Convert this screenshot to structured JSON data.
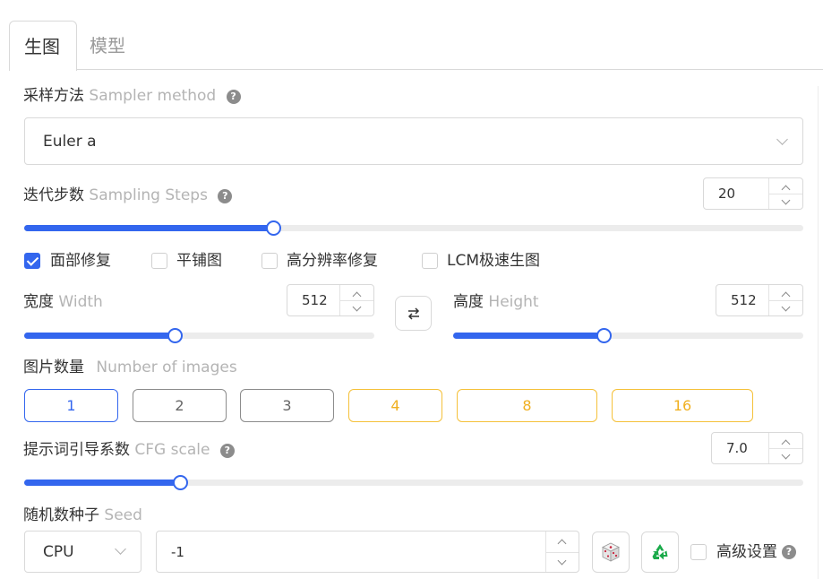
{
  "tabs": [
    {
      "label": "生图",
      "active": true
    },
    {
      "label": "模型",
      "active": false
    }
  ],
  "sampler": {
    "label_cn": "采样方法",
    "label_en": "Sampler method",
    "value": "Euler a"
  },
  "steps": {
    "label_cn": "迭代步数",
    "label_en": "Sampling Steps",
    "value": "20",
    "slider_fraction": 0.32
  },
  "options": [
    {
      "label": "面部修复",
      "checked": true
    },
    {
      "label": "平铺图",
      "checked": false
    },
    {
      "label": "高分辨率修复",
      "checked": false
    },
    {
      "label": "LCM极速生图",
      "checked": false
    }
  ],
  "width": {
    "label_cn": "宽度",
    "label_en": "Width",
    "value": "512",
    "slider_fraction": 0.43
  },
  "height": {
    "label_cn": "高度",
    "label_en": "Height",
    "value": "512",
    "slider_fraction": 0.43
  },
  "swap_icon": "swap-arrows-icon",
  "num_images": {
    "label_cn": "图片数量",
    "label_en": "Number of images",
    "options": [
      "1",
      "2",
      "3",
      "4",
      "8",
      "16"
    ],
    "selected": "1"
  },
  "cfg": {
    "label_cn": "提示词引导系数",
    "label_en": "CFG scale",
    "value": "7.0",
    "slider_fraction": 0.2
  },
  "seed": {
    "label_cn": "随机数种子",
    "label_en": "Seed",
    "device": "CPU",
    "value": "-1",
    "dice_icon": "dice-icon",
    "recycle_icon": "recycle-icon",
    "advanced_label": "高级设置",
    "advanced_checked": false
  },
  "colors": {
    "accent": "#3366ee",
    "warm": "#f0b020",
    "recycle": "#1aaa4a"
  }
}
